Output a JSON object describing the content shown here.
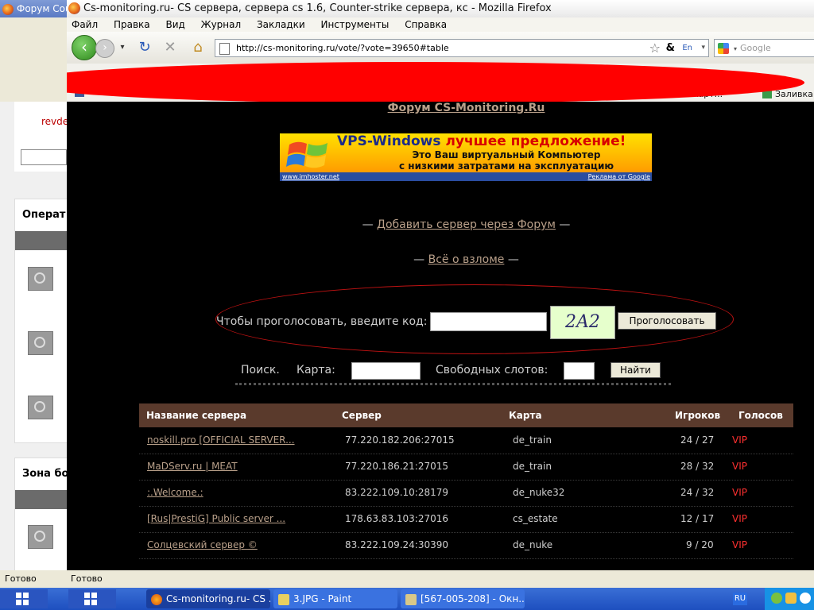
{
  "background_window": {
    "title": "Форум Cou",
    "link_text": "revde",
    "panel1_title": "Операт",
    "panel2_title": "Зона бо",
    "status": "Готово"
  },
  "browser": {
    "title": "Cs-monitoring.ru- CS сервера, сервера cs 1.6, Counter-strike сервера, кс - Mozilla Firefox",
    "menu": [
      "Файл",
      "Правка",
      "Вид",
      "Журнал",
      "Закладки",
      "Инструменты",
      "Справка"
    ],
    "url": "http://cs-monitoring.ru/vote/?vote=39650#table",
    "search_placeholder": "Google",
    "bookmarks_right": [
      "...ие карт...",
      "Заливка"
    ],
    "status": "Готово"
  },
  "page": {
    "forum_link": "Форум CS-Monitoring.Ru",
    "banner": {
      "line1_a": "VPS-Windows",
      "line1_b": "лучшее предложение!",
      "line2": "Это Ваш виртуальный Компьютер",
      "line3": "с низкими затратами на эксплуатацию",
      "footer_left": "www.imhoster.net",
      "footer_right": "Реклама от Google"
    },
    "add_server": {
      "prefix": "— ",
      "link": "Добавить сервер через Форум",
      "suffix": " —"
    },
    "hacking": {
      "prefix": "— ",
      "link": "Всё о взломе",
      "suffix": " —"
    },
    "vote": {
      "label": "Чтобы проголосовать, введите код:",
      "captcha": "2A2",
      "button": "Проголосовать"
    },
    "search": {
      "label": "Поиск.",
      "map_label": "Карта:",
      "slots_label": "Свободных слотов:",
      "button": "Найти"
    },
    "table": {
      "headers": [
        "Название сервера",
        "Сервер",
        "Карта",
        "Игроков",
        "Голосов"
      ],
      "rows": [
        {
          "name": "noskill.pro [OFFICIAL SERVER...",
          "server": "77.220.182.206:27015",
          "map": "de_train",
          "players": "24 / 27",
          "votes": "VIP"
        },
        {
          "name": "MaDServ.ru | MEAT",
          "server": "77.220.186.21:27015",
          "map": "de_train",
          "players": "28 / 32",
          "votes": "VIP"
        },
        {
          "name": ":.Welcome.:",
          "server": "83.222.109.10:28179",
          "map": "de_nuke32",
          "players": "24 / 32",
          "votes": "VIP"
        },
        {
          "name": "[Rus|PrestiG] Public server ...",
          "server": "178.63.83.103:27016",
          "map": "cs_estate",
          "players": "12 / 17",
          "votes": "VIP"
        },
        {
          "name": "Солцевский сервер ©",
          "server": "83.222.109.24:30390",
          "map": "de_nuke",
          "players": "9 / 20",
          "votes": "VIP"
        }
      ]
    }
  },
  "taskbar": {
    "tasks": [
      "Cs-monitoring.ru- CS ...",
      "3.JPG - Paint",
      "[567-005-208] - Окн..."
    ],
    "language": "RU"
  },
  "colors": {
    "link": "#b9a08a",
    "table_header_bg": "#5a3a2c",
    "vip": "#ff3030",
    "censor_red": "#ff0000",
    "vote_oval": "#c01212"
  }
}
